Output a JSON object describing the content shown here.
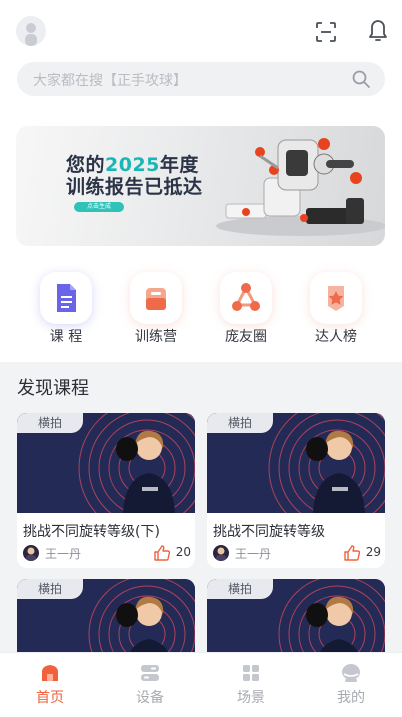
{
  "search": {
    "placeholder": "大家都在搜【正手攻球】"
  },
  "banner": {
    "line1_prefix": "您的",
    "line1_year": "2025",
    "line1_suffix": "年度",
    "line2": "训练报告已抵达",
    "button": "点击生成"
  },
  "categories": [
    {
      "label": "课 程",
      "icon": "course-doc-icon"
    },
    {
      "label": "训练营",
      "icon": "training-camp-icon"
    },
    {
      "label": "庞友圈",
      "icon": "community-icon"
    },
    {
      "label": "达人榜",
      "icon": "ranking-star-icon"
    }
  ],
  "section": {
    "title": "发现课程"
  },
  "courses": [
    {
      "tag": "横拍",
      "title": "挑战不同旋转等级(下)",
      "author": "王一丹",
      "likes": "20"
    },
    {
      "tag": "横拍",
      "title": "挑战不同旋转等级",
      "author": "王一丹",
      "likes": "29"
    },
    {
      "tag": "横拍"
    },
    {
      "tag": "横拍"
    }
  ],
  "tabbar": {
    "items": [
      {
        "label": "首页",
        "icon": "home-icon",
        "active": true
      },
      {
        "label": "设备",
        "icon": "device-icon",
        "active": false
      },
      {
        "label": "场景",
        "icon": "scene-grid-icon",
        "active": false
      },
      {
        "label": "我的",
        "icon": "profile-icon",
        "active": false
      }
    ]
  },
  "colors": {
    "accent": "#f0623e",
    "teal": "#19b6b5",
    "cardImage": "#242a56",
    "background": "#f2f3f5"
  }
}
